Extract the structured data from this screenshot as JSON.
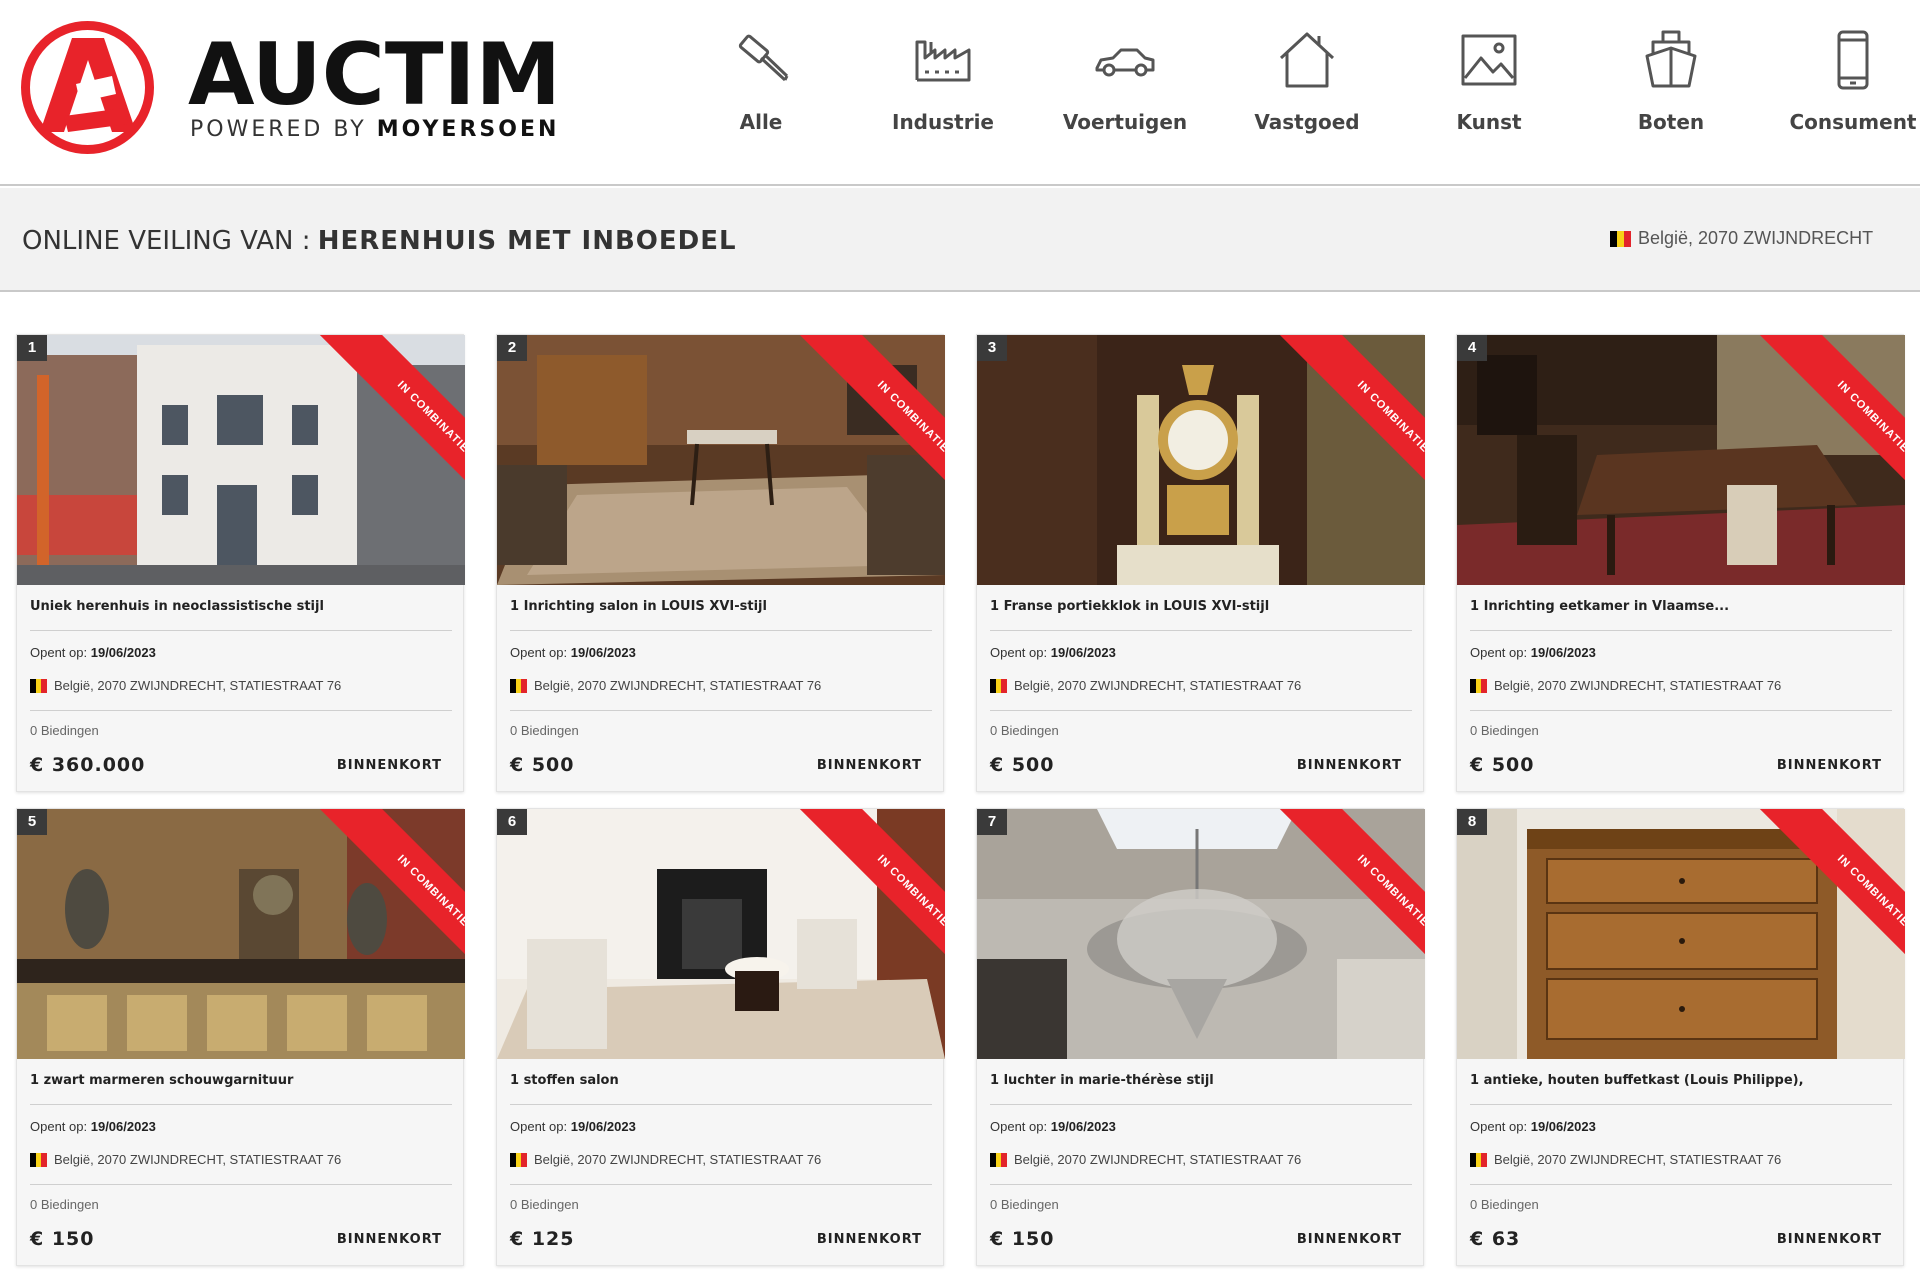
{
  "brand": {
    "name": "AUCTIM",
    "powered_by": "POWERED BY",
    "partner": "MOYERSOEN",
    "colors": {
      "red": "#e8232a",
      "dark": "#111111"
    }
  },
  "nav": {
    "items": [
      {
        "label": "Alle",
        "icon": "gavel-icon"
      },
      {
        "label": "Industrie",
        "icon": "factory-icon"
      },
      {
        "label": "Voertuigen",
        "icon": "car-icon"
      },
      {
        "label": "Vastgoed",
        "icon": "house-icon"
      },
      {
        "label": "Kunst",
        "icon": "picture-icon"
      },
      {
        "label": "Boten",
        "icon": "boat-icon"
      },
      {
        "label": "Consument",
        "icon": "smartphone-icon"
      }
    ]
  },
  "auction": {
    "title_prefix": "ONLINE VEILING VAN :",
    "title_name": "HERENHUIS MET INBOEDEL",
    "location": "België, 2070 ZWIJNDRECHT"
  },
  "card_labels": {
    "opens_label": "Opent op:",
    "ribbon": "In combinatie",
    "flag_icon": "belgium-flag-icon"
  },
  "lots": [
    {
      "number": "1",
      "title": "Uniek herenhuis in neoclassistische stijl",
      "opens": "19/06/2023",
      "address": "België, 2070 ZWIJNDRECHT, STATIESTRAAT 76",
      "bids": "0 Biedingen",
      "price": "€ 360.000",
      "status": "BINNENKORT",
      "image": "townhouse-facade-photo"
    },
    {
      "number": "2",
      "title": "1 Inrichting salon in LOUIS XVI-stijl",
      "opens": "19/06/2023",
      "address": "België, 2070 ZWIJNDRECHT, STATIESTRAAT 76",
      "bids": "0 Biedingen",
      "price": "€ 500",
      "status": "BINNENKORT",
      "image": "salon-room-photo"
    },
    {
      "number": "3",
      "title": "1 Franse portiekklok in LOUIS XVI-stijl",
      "opens": "19/06/2023",
      "address": "België, 2070 ZWIJNDRECHT, STATIESTRAAT 76",
      "bids": "0 Biedingen",
      "price": "€ 500",
      "status": "BINNENKORT",
      "image": "portico-clock-photo"
    },
    {
      "number": "4",
      "title": "1 Inrichting eetkamer in Vlaamse...",
      "opens": "19/06/2023",
      "address": "België, 2070 ZWIJNDRECHT, STATIESTRAAT 76",
      "bids": "0 Biedingen",
      "price": "€ 500",
      "status": "BINNENKORT",
      "image": "dining-room-photo"
    },
    {
      "number": "5",
      "title": "1 zwart marmeren schouwgarnituur",
      "opens": "19/06/2023",
      "address": "België, 2070 ZWIJNDRECHT, STATIESTRAAT 76",
      "bids": "0 Biedingen",
      "price": "€ 150",
      "status": "BINNENKORT",
      "image": "mantel-garniture-photo"
    },
    {
      "number": "6",
      "title": "1 stoffen salon",
      "opens": "19/06/2023",
      "address": "België, 2070 ZWIJNDRECHT, STATIESTRAAT 76",
      "bids": "0 Biedingen",
      "price": "€ 125",
      "status": "BINNENKORT",
      "image": "fabric-salon-photo"
    },
    {
      "number": "7",
      "title": "1 luchter in marie-thérèse stijl",
      "opens": "19/06/2023",
      "address": "België, 2070 ZWIJNDRECHT, STATIESTRAAT 76",
      "bids": "0 Biedingen",
      "price": "€ 150",
      "status": "BINNENKORT",
      "image": "chandelier-photo"
    },
    {
      "number": "8",
      "title": "1 antieke, houten buffetkast (Louis Philippe),",
      "opens": "19/06/2023",
      "address": "België, 2070 ZWIJNDRECHT, STATIESTRAAT 76",
      "bids": "0 Biedingen",
      "price": "€ 63",
      "status": "BINNENKORT",
      "image": "wooden-dresser-photo"
    }
  ]
}
